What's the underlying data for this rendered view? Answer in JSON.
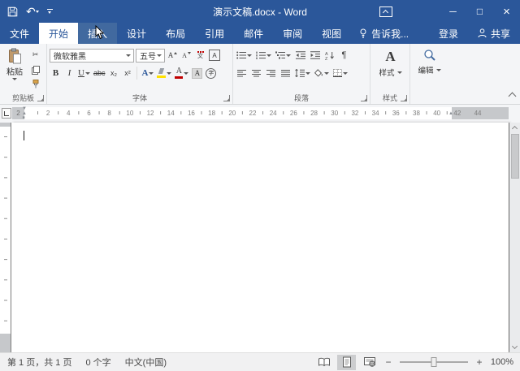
{
  "colors": {
    "accent": "#2B579A",
    "titlebar": "#2B579A",
    "ribbon_bg": "#F4F5F7",
    "document_bg": "#7E7E7E",
    "page_bg": "#FFFFFF",
    "statusbar_bg": "#F1F1F2",
    "font_color_red": "#C00000",
    "highlight_yellow": "#FFE100"
  },
  "titlebar": {
    "title": "演示文稿.docx - Word"
  },
  "icons": {
    "undo": "↶",
    "scissors": "✂",
    "pilcrow": "¶",
    "minimize": "─",
    "maximize": "□",
    "close": "×",
    "marker_down": "▼",
    "marker_up": "▲",
    "marker_square": "■"
  },
  "tabs": [
    {
      "label": "文件"
    },
    {
      "label": "开始"
    },
    {
      "label": "插入"
    },
    {
      "label": "设计"
    },
    {
      "label": "布局"
    },
    {
      "label": "引用"
    },
    {
      "label": "邮件"
    },
    {
      "label": "审阅"
    },
    {
      "label": "视图"
    },
    {
      "label": "告诉我..."
    },
    {
      "label": "登录"
    },
    {
      "label": "共享"
    }
  ],
  "ribbon": {
    "clipboard": {
      "group_label": "剪贴板",
      "paste_label": "粘贴"
    },
    "font": {
      "group_label": "字体",
      "name_value": "微软雅黑",
      "size_value": "五号",
      "grow": "A",
      "shrink": "A",
      "phonetic_char": "文",
      "char_border_letter": "A",
      "bold": "B",
      "italic": "I",
      "underline": "U",
      "strikethrough": "abc",
      "subscript": "x₂",
      "superscript": "x²",
      "text_effects_letter": "A",
      "font_color_letter": "A",
      "char_shading_letter": "A",
      "enclose_letter": "字"
    },
    "paragraph": {
      "group_label": "段落",
      "sort_a": "A",
      "sort_z": "Z"
    },
    "styles": {
      "group_label": "样式",
      "button_label": "样式",
      "icon_letter": "A"
    },
    "editing": {
      "button_label": "编辑"
    }
  },
  "ruler": {
    "margin_number": "2",
    "numbers": [
      "2",
      "4",
      "6",
      "8",
      "10",
      "12",
      "14",
      "16",
      "18",
      "20",
      "22",
      "24",
      "26",
      "28",
      "30",
      "32",
      "34",
      "36",
      "38",
      "40",
      "42",
      "44"
    ]
  },
  "statusbar": {
    "page_info": "第 1 页，共 1 页",
    "word_count": "0 个字",
    "language": "中文(中国)",
    "zoom_out": "−",
    "zoom_in": "+",
    "zoom_level": "100%"
  }
}
